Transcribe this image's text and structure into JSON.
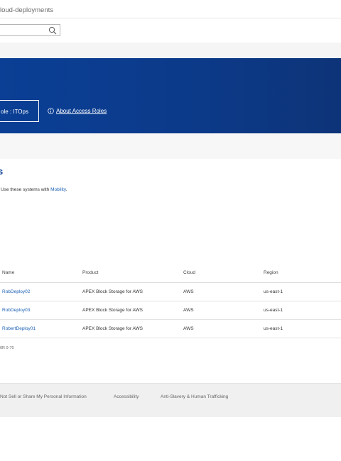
{
  "header": {
    "breadcrumb": "loud-deployments"
  },
  "search": {
    "placeholder": "",
    "value": "",
    "icon": "search-icon"
  },
  "banner": {
    "role_label": "ole : ITOps",
    "about_link": "About Access Roles",
    "about_icon": "info-icon",
    "color": "#0a3f95"
  },
  "section": {
    "title": "s",
    "description_prefix": "Use these systems with ",
    "description_link": "Mobility",
    "description_suffix": "."
  },
  "table": {
    "columns": [
      "Name",
      "Product",
      "Cloud",
      "Region"
    ],
    "rows": [
      {
        "name": "RobDeploy02",
        "product": "APEX Block Storage for AWS",
        "cloud": "AWS",
        "region": "us-east-1"
      },
      {
        "name": "RobDeploy03",
        "product": "APEX Block Storage for AWS",
        "cloud": "AWS",
        "region": "us-east-1"
      },
      {
        "name": "RobertDeploy01",
        "product": "APEX Block Storage for AWS",
        "cloud": "AWS",
        "region": "us-east-1"
      }
    ]
  },
  "version": "0R 0-70",
  "footer": {
    "links": [
      "Not Sell or Share My Personal Information",
      "Accessibility",
      "Anti-Slavery & Human Trafficking"
    ]
  }
}
